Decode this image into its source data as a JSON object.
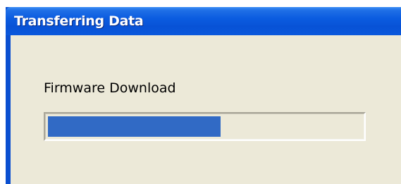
{
  "window": {
    "title": "Transferring Data"
  },
  "dialog": {
    "label": "Firmware Download",
    "progress_fraction": 0.55
  },
  "colors": {
    "titlebar": "#0a58dc",
    "client_background": "#ece9d8",
    "progress_fill": "#316ac5"
  }
}
